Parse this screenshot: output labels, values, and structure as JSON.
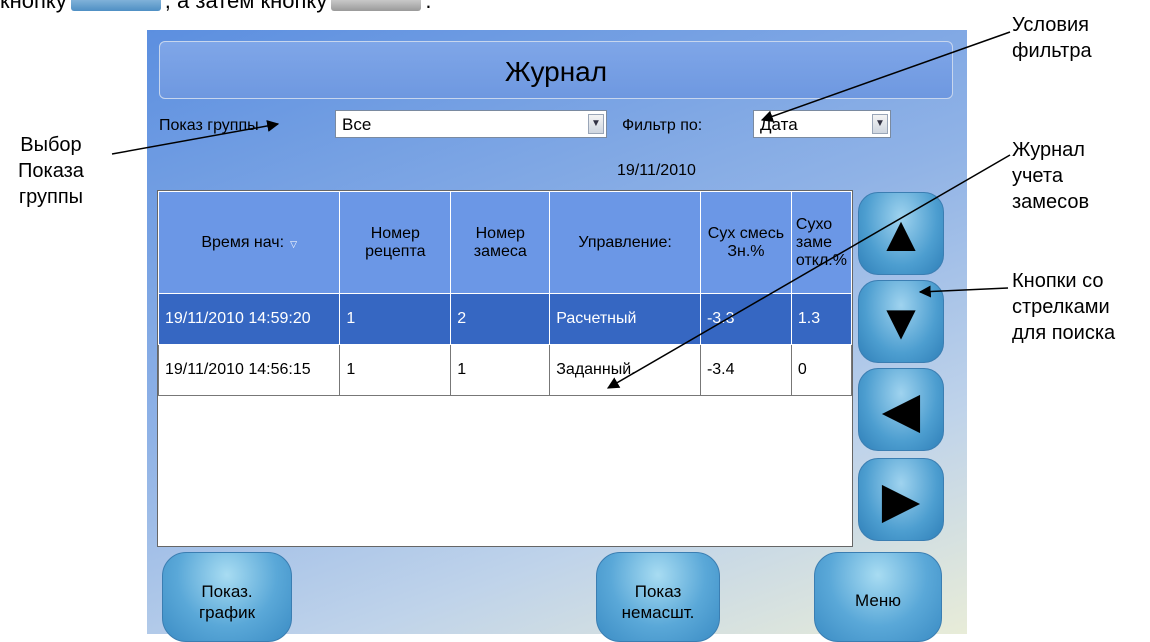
{
  "clipped_header": {
    "left": "кнопку",
    "mid": ", а затем кнопку",
    "end": "."
  },
  "window": {
    "title": "Журнал",
    "show_group": {
      "label": "Показ группы",
      "value": "Все"
    },
    "filter": {
      "label": "Фильтр по:",
      "value": "Дата"
    },
    "date": "19/11/2010",
    "table": {
      "columns": [
        "Время нач:",
        "Номер рецепта",
        "Номер замеса",
        "Управление:",
        "Сух смесь Зн.%",
        "Сухо заме откл.%"
      ],
      "rows": [
        [
          "19/11/2010 14:59:20",
          "1",
          "2",
          "Расчетный",
          "-3.3",
          "1.3"
        ],
        [
          "19/11/2010 14:56:15",
          "1",
          "1",
          "Заданный.",
          "-3.4",
          "0"
        ]
      ],
      "selected_row": 0
    },
    "nav_buttons": [
      "up-arrow-icon",
      "down-arrow-icon",
      "left-arrow-icon",
      "right-arrow-icon"
    ],
    "bottom_buttons": {
      "graph": "Показ.\nграфик",
      "unscaled": "Показ\nнемасшт.",
      "menu": "Меню"
    }
  },
  "annotations": {
    "group_select": "Выбор\nПоказа\nгруппы",
    "filter_conditions": "Условия\nфильтра",
    "log": "Журнал\nучета\nзамесов",
    "arrow_buttons": "Кнопки со\nстрелками\nдля поиска"
  },
  "colors": {
    "header_blue": "#6b97e6",
    "selected_row": "#3667c2",
    "nav_button": "#4d9ed0"
  }
}
